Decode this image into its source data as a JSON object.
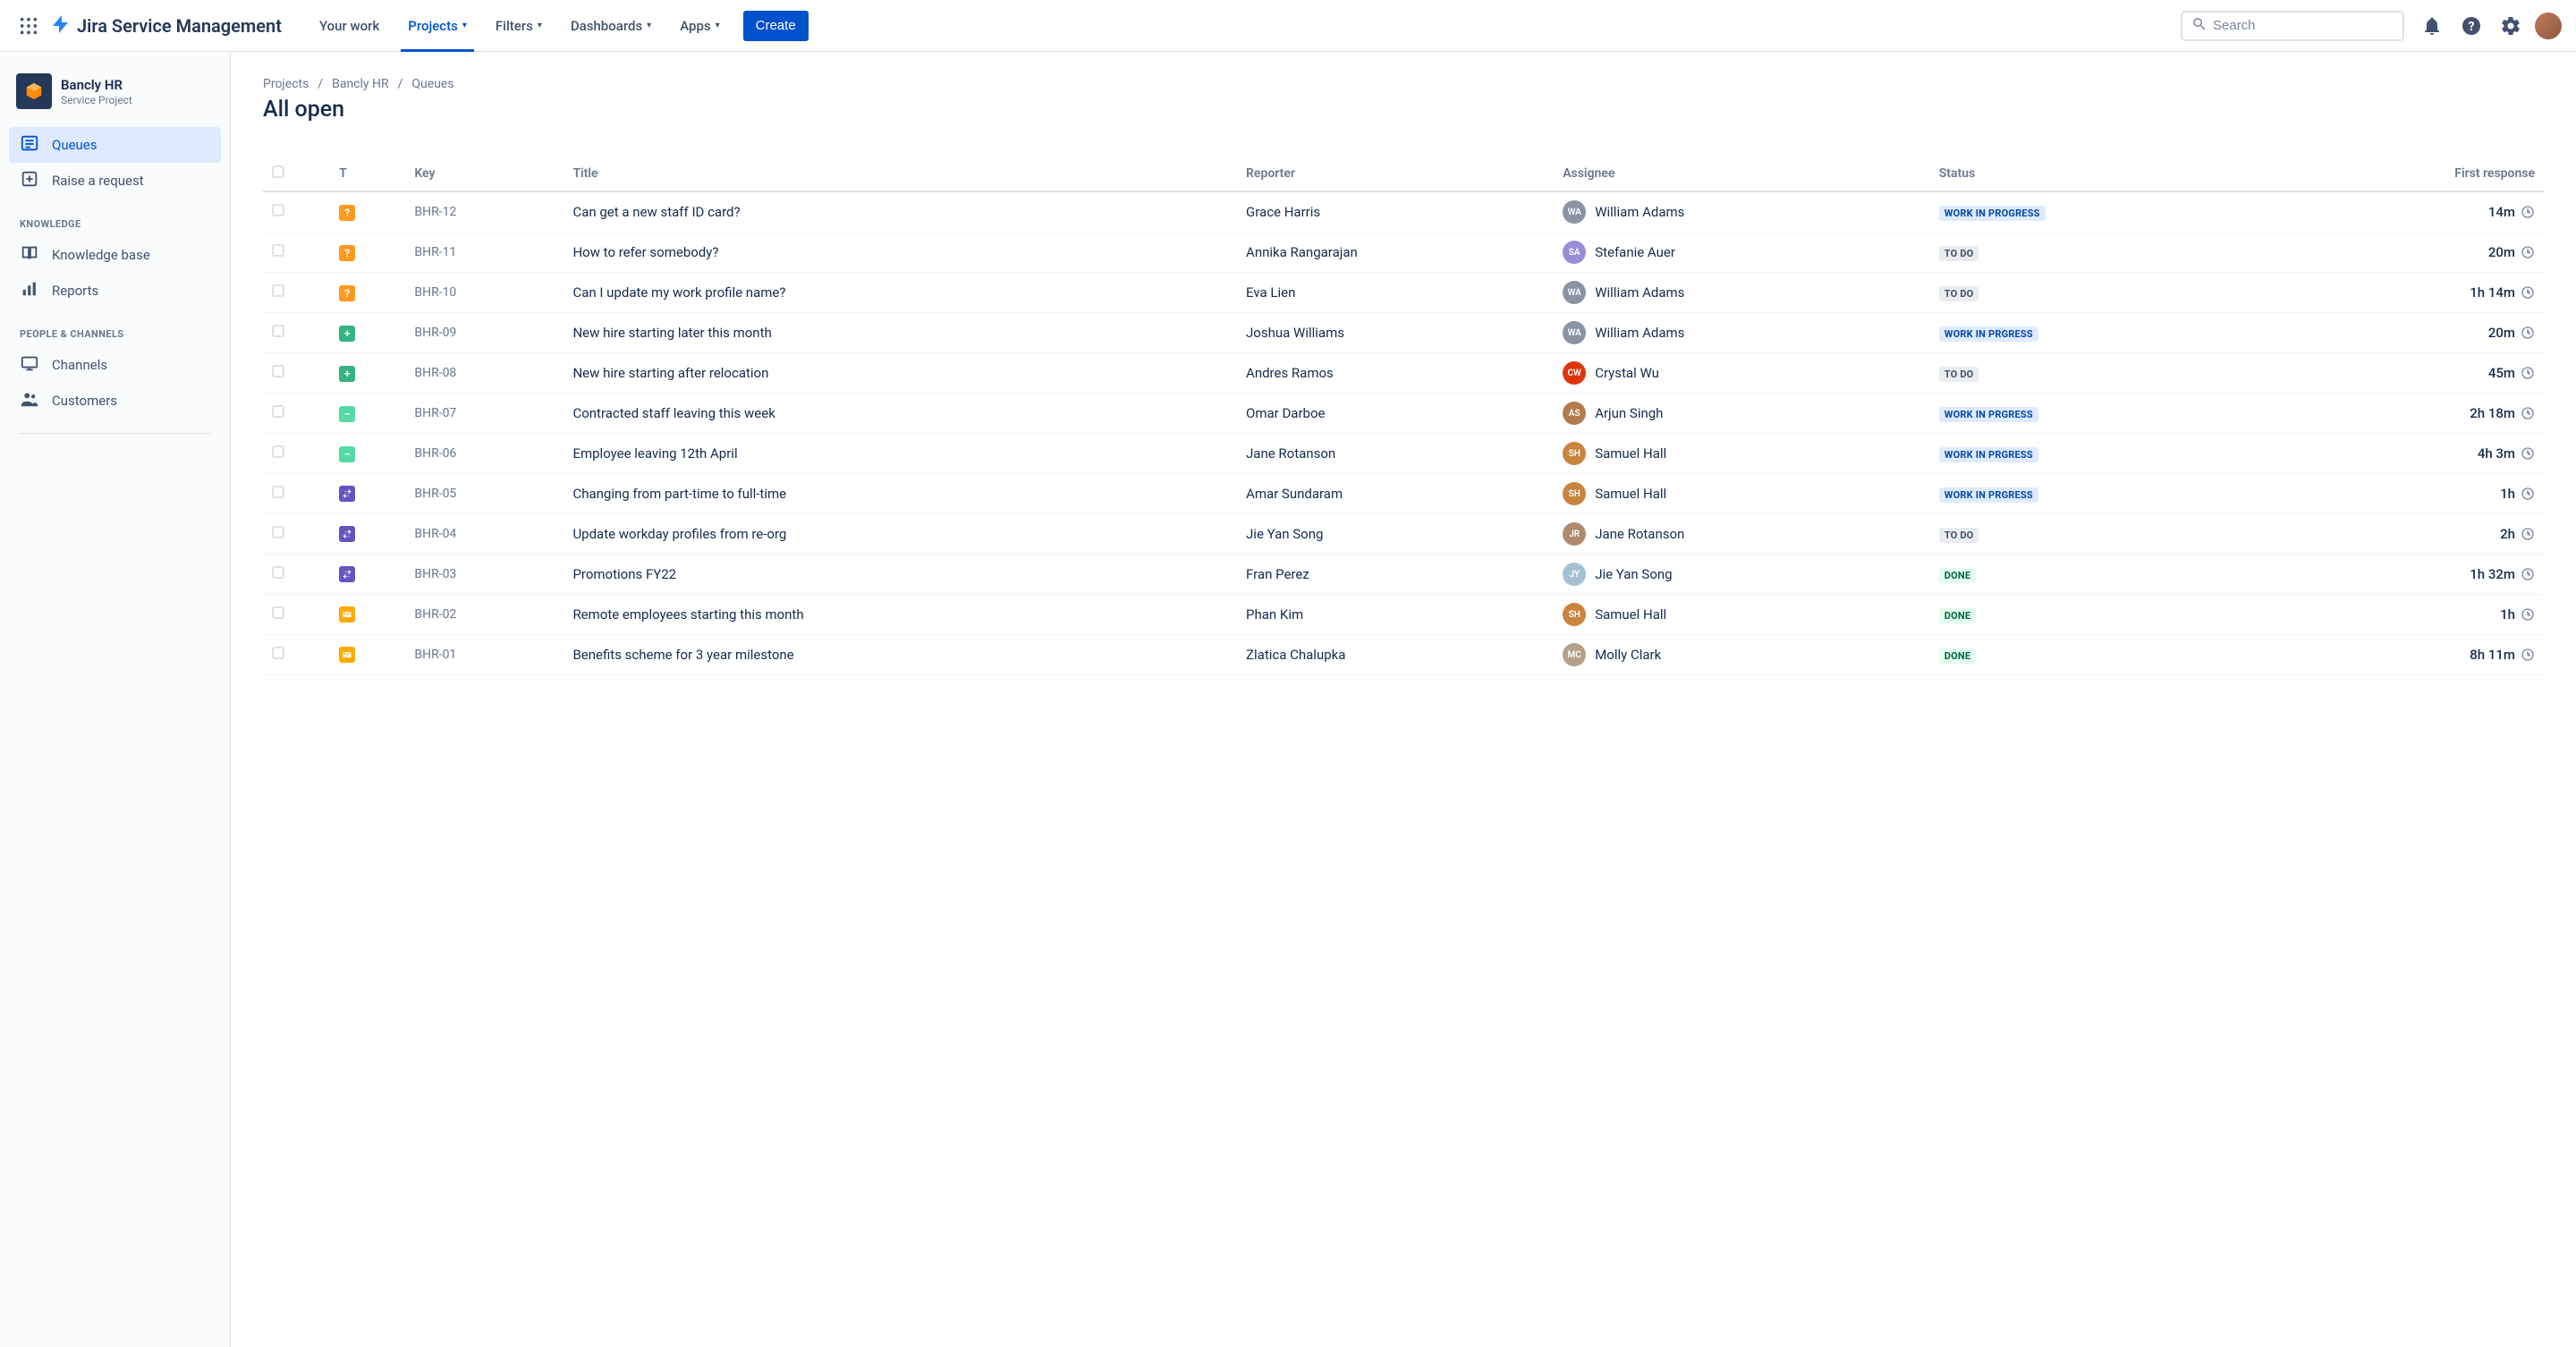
{
  "brand": "Jira Service Management",
  "topnav": {
    "items": [
      {
        "label": "Your work",
        "active": false,
        "dropdown": false
      },
      {
        "label": "Projects",
        "active": true,
        "dropdown": true
      },
      {
        "label": "Filters",
        "active": false,
        "dropdown": true
      },
      {
        "label": "Dashboards",
        "active": false,
        "dropdown": true
      },
      {
        "label": "Apps",
        "active": false,
        "dropdown": true
      }
    ],
    "create": "Create",
    "search_placeholder": "Search"
  },
  "sidebar": {
    "project_name": "Bancly HR",
    "project_type": "Service Project",
    "items_main": [
      {
        "label": "Queues",
        "icon": "queues",
        "active": true
      },
      {
        "label": "Raise a request",
        "icon": "raise",
        "active": false
      }
    ],
    "section_knowledge": "KNOWLEDGE",
    "items_knowledge": [
      {
        "label": "Knowledge base",
        "icon": "kb"
      },
      {
        "label": "Reports",
        "icon": "reports"
      }
    ],
    "section_people": "PEOPLE & CHANNELS",
    "items_people": [
      {
        "label": "Channels",
        "icon": "channels"
      },
      {
        "label": "Customers",
        "icon": "customers"
      }
    ]
  },
  "breadcrumbs": [
    "Projects",
    "Bancly HR",
    "Queues"
  ],
  "page_title": "All open",
  "columns": {
    "t": "T",
    "key": "Key",
    "title": "Title",
    "reporter": "Reporter",
    "assignee": "Assignee",
    "status": "Status",
    "first_response": "First response"
  },
  "status_labels": {
    "progress": "WORK IN PROGRESS",
    "progress2": "WORK IN PRGRESS",
    "todo": "TO DO",
    "done": "DONE"
  },
  "rows": [
    {
      "type": "question",
      "key": "BHR-12",
      "title": "Can get a new staff ID card?",
      "reporter": "Grace Harris",
      "assignee": "William Adams",
      "assignee_color": "#8993A4",
      "status": "progress",
      "response": "14m"
    },
    {
      "type": "question",
      "key": "BHR-11",
      "title": "How to refer somebody?",
      "reporter": "Annika Rangarajan",
      "assignee": "Stefanie Auer",
      "assignee_color": "#998DD9",
      "status": "todo",
      "response": "20m"
    },
    {
      "type": "question",
      "key": "BHR-10",
      "title": "Can I update my work profile name?",
      "reporter": "Eva Lien",
      "assignee": "William Adams",
      "assignee_color": "#8993A4",
      "status": "todo",
      "response": "1h 14m"
    },
    {
      "type": "plus",
      "key": "BHR-09",
      "title": "New hire starting later this month",
      "reporter": "Joshua Williams",
      "assignee": "William Adams",
      "assignee_color": "#8993A4",
      "status": "progress2",
      "response": "20m"
    },
    {
      "type": "plus",
      "key": "BHR-08",
      "title": "New hire starting after relocation",
      "reporter": "Andres Ramos",
      "assignee": "Crystal Wu",
      "assignee_color": "#DE350B",
      "status": "todo",
      "response": "45m"
    },
    {
      "type": "minus",
      "key": "BHR-07",
      "title": "Contracted staff leaving this week",
      "reporter": "Omar Darboe",
      "assignee": "Arjun Singh",
      "assignee_color": "#b37b4e",
      "status": "progress2",
      "response": "2h 18m"
    },
    {
      "type": "minus",
      "key": "BHR-06",
      "title": "Employee leaving 12th April",
      "reporter": "Jane Rotanson",
      "assignee": "Samuel Hall",
      "assignee_color": "#c9843f",
      "status": "progress2",
      "response": "4h 3m"
    },
    {
      "type": "swap",
      "key": "BHR-05",
      "title": "Changing from part-time to full-time",
      "reporter": "Amar Sundaram",
      "assignee": "Samuel Hall",
      "assignee_color": "#c9843f",
      "status": "progress2",
      "response": "1h"
    },
    {
      "type": "swap",
      "key": "BHR-04",
      "title": "Update workday profiles from re-org",
      "reporter": "Jie Yan Song",
      "assignee": "Jane Rotanson",
      "assignee_color": "#b08a6e",
      "status": "todo",
      "response": "2h"
    },
    {
      "type": "swap",
      "key": "BHR-03",
      "title": "Promotions FY22",
      "reporter": "Fran Perez",
      "assignee": "Jie Yan Song",
      "assignee_color": "#a5c0d1",
      "status": "done",
      "response": "1h 32m"
    },
    {
      "type": "mail",
      "key": "BHR-02",
      "title": "Remote employees starting this month",
      "reporter": "Phan Kim",
      "assignee": "Samuel Hall",
      "assignee_color": "#c9843f",
      "status": "done",
      "response": "1h"
    },
    {
      "type": "mail",
      "key": "BHR-01",
      "title": "Benefits scheme for 3 year milestone",
      "reporter": "Zlatica Chalupka",
      "assignee": "Molly Clark",
      "assignee_color": "#b5a08c",
      "status": "done",
      "response": "8h 11m"
    }
  ]
}
